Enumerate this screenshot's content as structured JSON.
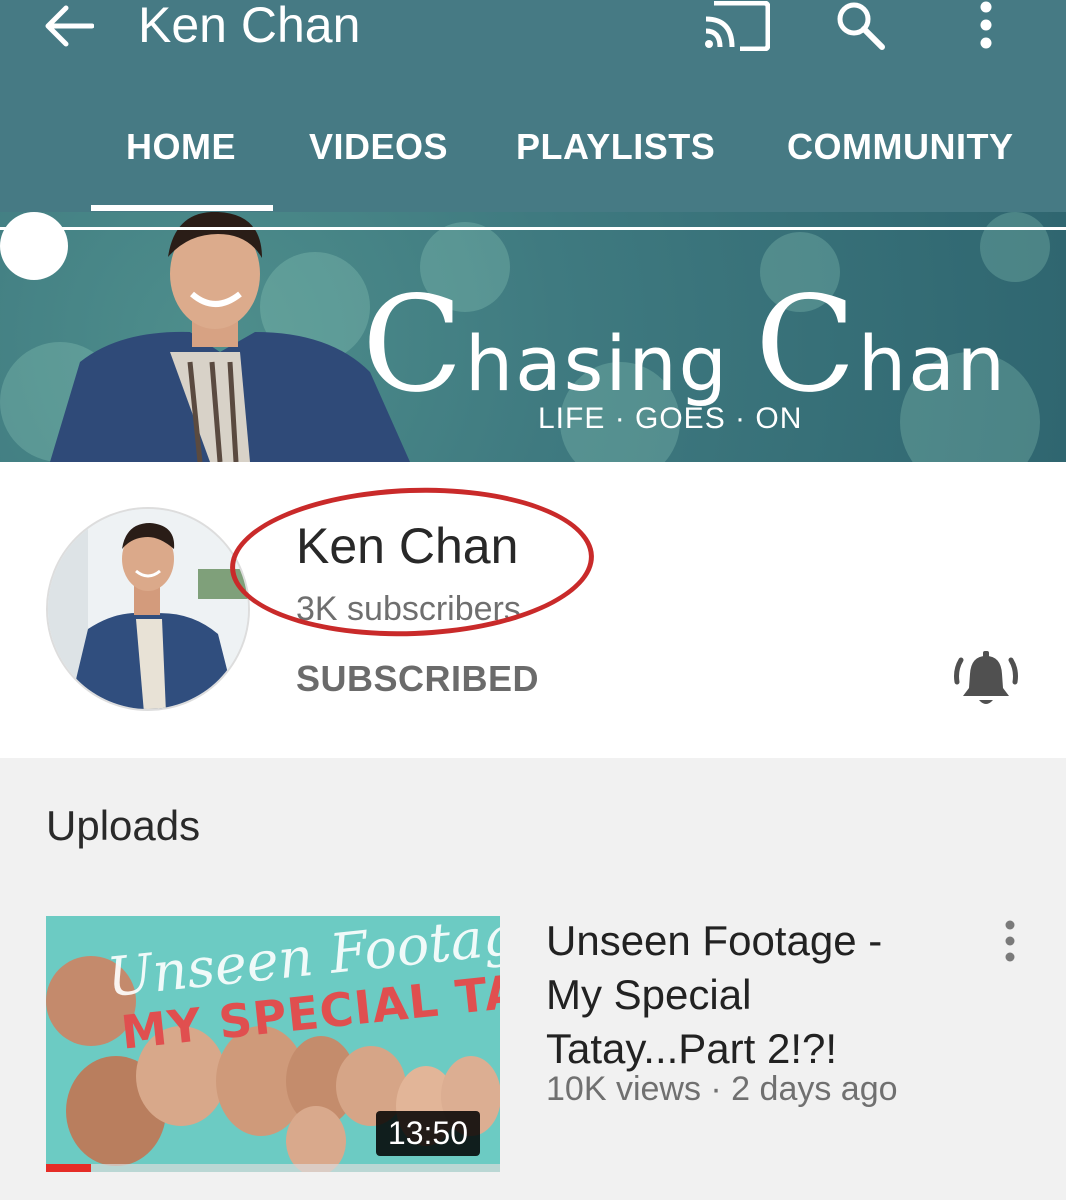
{
  "appbar": {
    "title": "Ken Chan",
    "icons": [
      "back-arrow-icon",
      "cast-icon",
      "search-icon",
      "more-vert-icon"
    ]
  },
  "tabs": [
    {
      "label": "HOME",
      "selected": true
    },
    {
      "label": "VIDEOS",
      "selected": false
    },
    {
      "label": "PLAYLISTS",
      "selected": false
    },
    {
      "label": "COMMUNITY",
      "selected": false
    }
  ],
  "banner": {
    "title": "Chasing Chan",
    "title_cap_1": "C",
    "title_rest_1": "hasing ",
    "title_cap_2": "C",
    "title_rest_2": "han",
    "subtitle": "LIFE · GOES · ON"
  },
  "channel": {
    "name": "Ken Chan",
    "subscribers": "3K subscribers",
    "subscribe_state": "SUBSCRIBED",
    "notification_icon": "bell-ringing-icon"
  },
  "uploads": {
    "section_title": "Uploads",
    "videos": [
      {
        "title": "Unseen Footage - My Special Tatay...Part 2!?!",
        "views": "10K views",
        "age": "2 days ago",
        "meta": "10K views · 2 days ago",
        "duration": "13:50",
        "thumb_line1": "Unseen Footage!",
        "thumb_line2": "MY SPECIAL TATAY",
        "watch_progress": 0.1
      }
    ]
  },
  "colors": {
    "appbar": "#467a84",
    "annotation_circle": "#c92a2a",
    "progress_red": "#e52d27"
  }
}
